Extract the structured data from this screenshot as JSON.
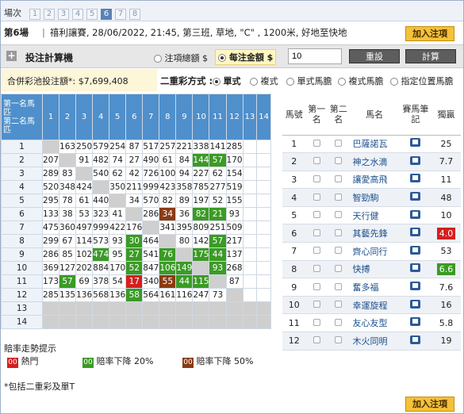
{
  "header": {
    "venue_label": "場次",
    "race_tabs": [
      "1",
      "2",
      "3",
      "4",
      "5",
      "6",
      "7",
      "8"
    ],
    "active_tab": "6",
    "race_no": "第6場",
    "race_info": "禧利讓賽, 28/06/2022, 21:45, 第三班, 草地, \"C\" , 1200米, 好地至快地",
    "add_slip_label": "加入注項"
  },
  "calculator": {
    "title": "投注計算機",
    "opt_total": "注項總額 $",
    "opt_unit": "每注金額 $",
    "amount_value": "10",
    "reset_label": "重設",
    "calc_label": "計算"
  },
  "pool": {
    "text": "合併彩池投注額*: $7,699,408"
  },
  "bet_type": {
    "label": "二重彩方式 :",
    "options": [
      "單式",
      "複式",
      "單式馬膽",
      "複式馬膽",
      "指定位置馬膽"
    ],
    "selected": "單式"
  },
  "grid": {
    "corner_top": "第一名馬匹",
    "corner_bottom": "第二名馬匹",
    "cols": [
      "1",
      "2",
      "3",
      "4",
      "5",
      "6",
      "7",
      "8",
      "9",
      "10",
      "11",
      "12",
      "13",
      "14"
    ],
    "rows": [
      {
        "h": "1",
        "v": [
          "",
          "163",
          "250",
          "579",
          "254",
          "87",
          "517",
          "257",
          "221",
          "338",
          "141",
          "285",
          "",
          ""
        ],
        "c": [
          "gr",
          "",
          "",
          "",
          "",
          "",
          "",
          "",
          "",
          "",
          "",
          "",
          "",
          ""
        ]
      },
      {
        "h": "2",
        "v": [
          "207",
          "",
          "91",
          "482",
          "74",
          "27",
          "490",
          "61",
          "84",
          "144",
          "57",
          "170",
          "",
          ""
        ],
        "c": [
          "",
          "gr",
          "",
          "",
          "",
          "",
          "",
          "",
          "",
          "g",
          "g",
          "",
          "",
          ""
        ]
      },
      {
        "h": "3",
        "v": [
          "289",
          "83",
          "",
          "540",
          "62",
          "42",
          "726",
          "100",
          "94",
          "227",
          "62",
          "154",
          "",
          ""
        ],
        "c": [
          "",
          "",
          "gr",
          "",
          "",
          "",
          "",
          "",
          "",
          "",
          "",
          "",
          "",
          ""
        ]
      },
      {
        "h": "4",
        "v": [
          "520",
          "348",
          "424",
          "",
          "350",
          "211",
          "999",
          "423",
          "358",
          "785",
          "277",
          "519",
          "",
          ""
        ],
        "c": [
          "",
          "",
          "",
          "gr",
          "",
          "",
          "",
          "",
          "",
          "",
          "",
          "",
          "",
          ""
        ]
      },
      {
        "h": "5",
        "v": [
          "295",
          "78",
          "61",
          "440",
          "",
          "34",
          "570",
          "82",
          "89",
          "197",
          "52",
          "155",
          "",
          ""
        ],
        "c": [
          "",
          "",
          "",
          "",
          "gr",
          "",
          "",
          "",
          "",
          "",
          "",
          "",
          "",
          ""
        ]
      },
      {
        "h": "6",
        "v": [
          "133",
          "38",
          "53",
          "323",
          "41",
          "",
          "286",
          "34",
          "36",
          "82",
          "21",
          "93",
          "",
          ""
        ],
        "c": [
          "",
          "",
          "",
          "",
          "",
          "gr",
          "",
          "b",
          "",
          "g",
          "g",
          "",
          "",
          ""
        ]
      },
      {
        "h": "7",
        "v": [
          "475",
          "360",
          "497",
          "999",
          "422",
          "176",
          "",
          "341",
          "395",
          "809",
          "251",
          "509",
          "",
          ""
        ],
        "c": [
          "",
          "",
          "",
          "",
          "",
          "",
          "gr",
          "",
          "",
          "",
          "",
          "",
          "",
          ""
        ]
      },
      {
        "h": "8",
        "v": [
          "299",
          "67",
          "114",
          "573",
          "93",
          "30",
          "464",
          "",
          "80",
          "142",
          "57",
          "217",
          "",
          ""
        ],
        "c": [
          "",
          "",
          "",
          "",
          "",
          "g",
          "",
          "gr",
          "",
          "",
          "g",
          "",
          "",
          ""
        ]
      },
      {
        "h": "9",
        "v": [
          "286",
          "85",
          "102",
          "474",
          "95",
          "27",
          "541",
          "76",
          "",
          "175",
          "44",
          "137",
          "",
          ""
        ],
        "c": [
          "",
          "",
          "",
          "g",
          "",
          "g",
          "",
          "g",
          "gr",
          "g",
          "g",
          "",
          "",
          ""
        ]
      },
      {
        "h": "10",
        "v": [
          "369",
          "127",
          "202",
          "884",
          "170",
          "52",
          "847",
          "106",
          "149",
          "",
          "93",
          "268",
          "",
          ""
        ],
        "c": [
          "",
          "",
          "",
          "",
          "",
          "g",
          "",
          "g",
          "g",
          "gr",
          "g",
          "",
          "",
          ""
        ]
      },
      {
        "h": "11",
        "v": [
          "173",
          "57",
          "69",
          "378",
          "54",
          "17",
          "340",
          "55",
          "44",
          "115",
          "",
          "87",
          "",
          ""
        ],
        "c": [
          "",
          "g",
          "",
          "",
          "",
          "r",
          "",
          "b",
          "g",
          "g",
          "gr",
          "",
          "",
          ""
        ]
      },
      {
        "h": "12",
        "v": [
          "285",
          "135",
          "136",
          "568",
          "136",
          "58",
          "564",
          "161",
          "116",
          "247",
          "73",
          "",
          "",
          ""
        ],
        "c": [
          "",
          "",
          "",
          "",
          "",
          "g",
          "",
          "",
          "",
          "",
          "",
          "gr",
          "",
          ""
        ]
      },
      {
        "h": "13",
        "v": [
          "",
          "",
          "",
          "",
          "",
          "",
          "",
          "",
          "",
          "",
          "",
          "",
          "",
          ""
        ],
        "c": [
          "gr",
          "gr",
          "gr",
          "gr",
          "gr",
          "gr",
          "gr",
          "gr",
          "gr",
          "gr",
          "gr",
          "gr",
          "gr",
          "gr"
        ]
      },
      {
        "h": "14",
        "v": [
          "",
          "",
          "",
          "",
          "",
          "",
          "",
          "",
          "",
          "",
          "",
          "",
          "",
          ""
        ],
        "c": [
          "gr",
          "gr",
          "gr",
          "gr",
          "gr",
          "gr",
          "gr",
          "gr",
          "gr",
          "gr",
          "gr",
          "gr",
          "gr",
          "gr"
        ]
      }
    ]
  },
  "horses": {
    "headers": {
      "no": "馬號",
      "first": "第一名",
      "second": "第二名",
      "name": "馬名",
      "notes": "賽馬筆記",
      "win": "獨贏"
    },
    "rows": [
      {
        "no": "1",
        "name": "巴薩諾瓦",
        "win": "25",
        "style": ""
      },
      {
        "no": "2",
        "name": "神之水滴",
        "win": "7.7",
        "style": ""
      },
      {
        "no": "3",
        "name": "讓愛高飛",
        "win": "11",
        "style": ""
      },
      {
        "no": "4",
        "name": "智勁駒",
        "win": "48",
        "style": ""
      },
      {
        "no": "5",
        "name": "天行健",
        "win": "10",
        "style": ""
      },
      {
        "no": "6",
        "name": "其藝先鋒",
        "win": "4.0",
        "style": "red"
      },
      {
        "no": "7",
        "name": "齊心同行",
        "win": "53",
        "style": ""
      },
      {
        "no": "8",
        "name": "快搏",
        "win": "6.6",
        "style": "green"
      },
      {
        "no": "9",
        "name": "奮多福",
        "win": "7.6",
        "style": ""
      },
      {
        "no": "10",
        "name": "幸運旋程",
        "win": "16",
        "style": ""
      },
      {
        "no": "11",
        "name": "友心友型",
        "win": "5.8",
        "style": ""
      },
      {
        "no": "12",
        "name": "木火同明",
        "win": "19",
        "style": ""
      }
    ]
  },
  "legend": {
    "title": "賠率走勢提示",
    "hot": "熱門",
    "drop20": "賠率下降 20%",
    "drop50": "賠率下降 50%",
    "chip": "00"
  },
  "footnote": "*包括二重彩及單T",
  "colors": {
    "accent_blue": "#4f8fcb",
    "green": "#3b9b25",
    "brown": "#8a3b14",
    "red": "#d51f1f",
    "orange_btn": "#f4c13a"
  }
}
